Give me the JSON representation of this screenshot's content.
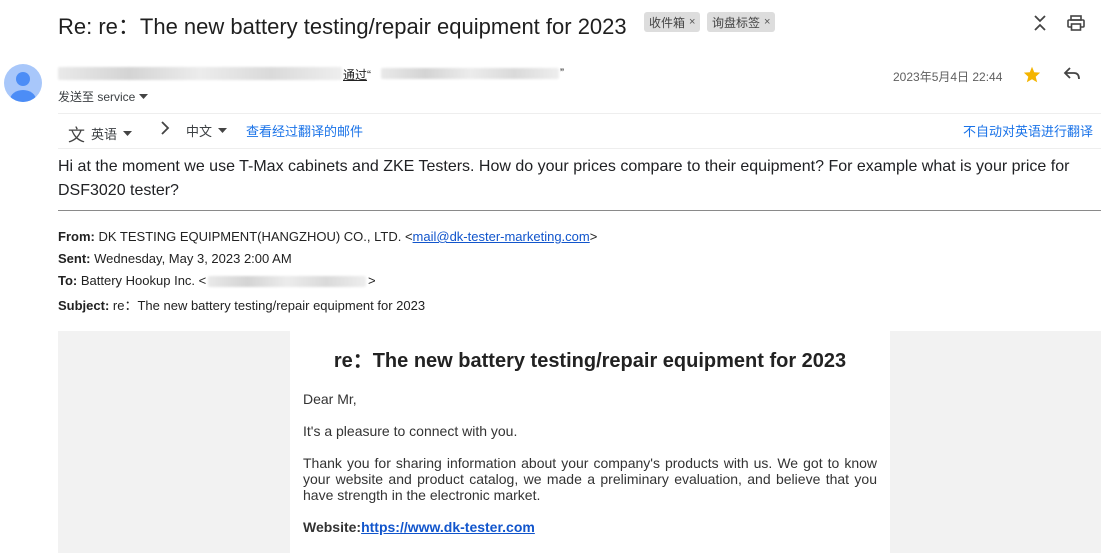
{
  "header": {
    "subject": "Re: re：The new battery testing/repair equipment for 2023",
    "labels": [
      {
        "text": "收件箱",
        "close": "×"
      },
      {
        "text": "询盘标签",
        "close": "×"
      }
    ],
    "icons": [
      "expand-collapse-icon",
      "print-icon"
    ]
  },
  "sender": {
    "via_text": "通过",
    "via_quote_open": "“",
    "via_quote_close": "”",
    "sent_to": "发送至 service",
    "date": "2023年5月4日 22:44",
    "starred": true,
    "star_color": "#f4b400"
  },
  "translate_bar": {
    "source_lang": "英语",
    "target_lang": "中文",
    "view_translated": "查看经过翻译的邮件",
    "no_auto": "不自动对英语进行翻译"
  },
  "message": {
    "body": "Hi at the moment we use T-Max cabinets and ZKE Testers. How do your prices compare to their equipment? For example what is your price for DSF3020 tester?"
  },
  "quoted": {
    "from_label": "From:",
    "from_name": "DK TESTING EQUIPMENT(HANGZHOU) CO., LTD. <",
    "from_email": "mail@dk-tester-marketing.com",
    "from_close": ">",
    "sent_label": "Sent:",
    "sent_value": "Wednesday, May 3, 2023 2:00 AM",
    "to_label": "To:",
    "to_value": "Battery Hookup Inc. <",
    "to_close": ">",
    "subject_label": "Subject:",
    "subject_value": "re：The new battery testing/repair equipment for 2023"
  },
  "card": {
    "title": "re：The new battery testing/repair equipment for 2023",
    "greeting": "Dear Mr,",
    "p1": "It's a pleasure to connect with you.",
    "p2": "Thank you for sharing information about your company's products with us. We got to know your website and product catalog, we made a preliminary evaluation, and believe that you have strength in the electronic market.",
    "website_label": "Website:",
    "website_url": "https://www.dk-tester.com"
  },
  "colors": {
    "link": "#1a73e8",
    "avatar": "#a8c7fa",
    "chip_bg": "#dddddd"
  }
}
